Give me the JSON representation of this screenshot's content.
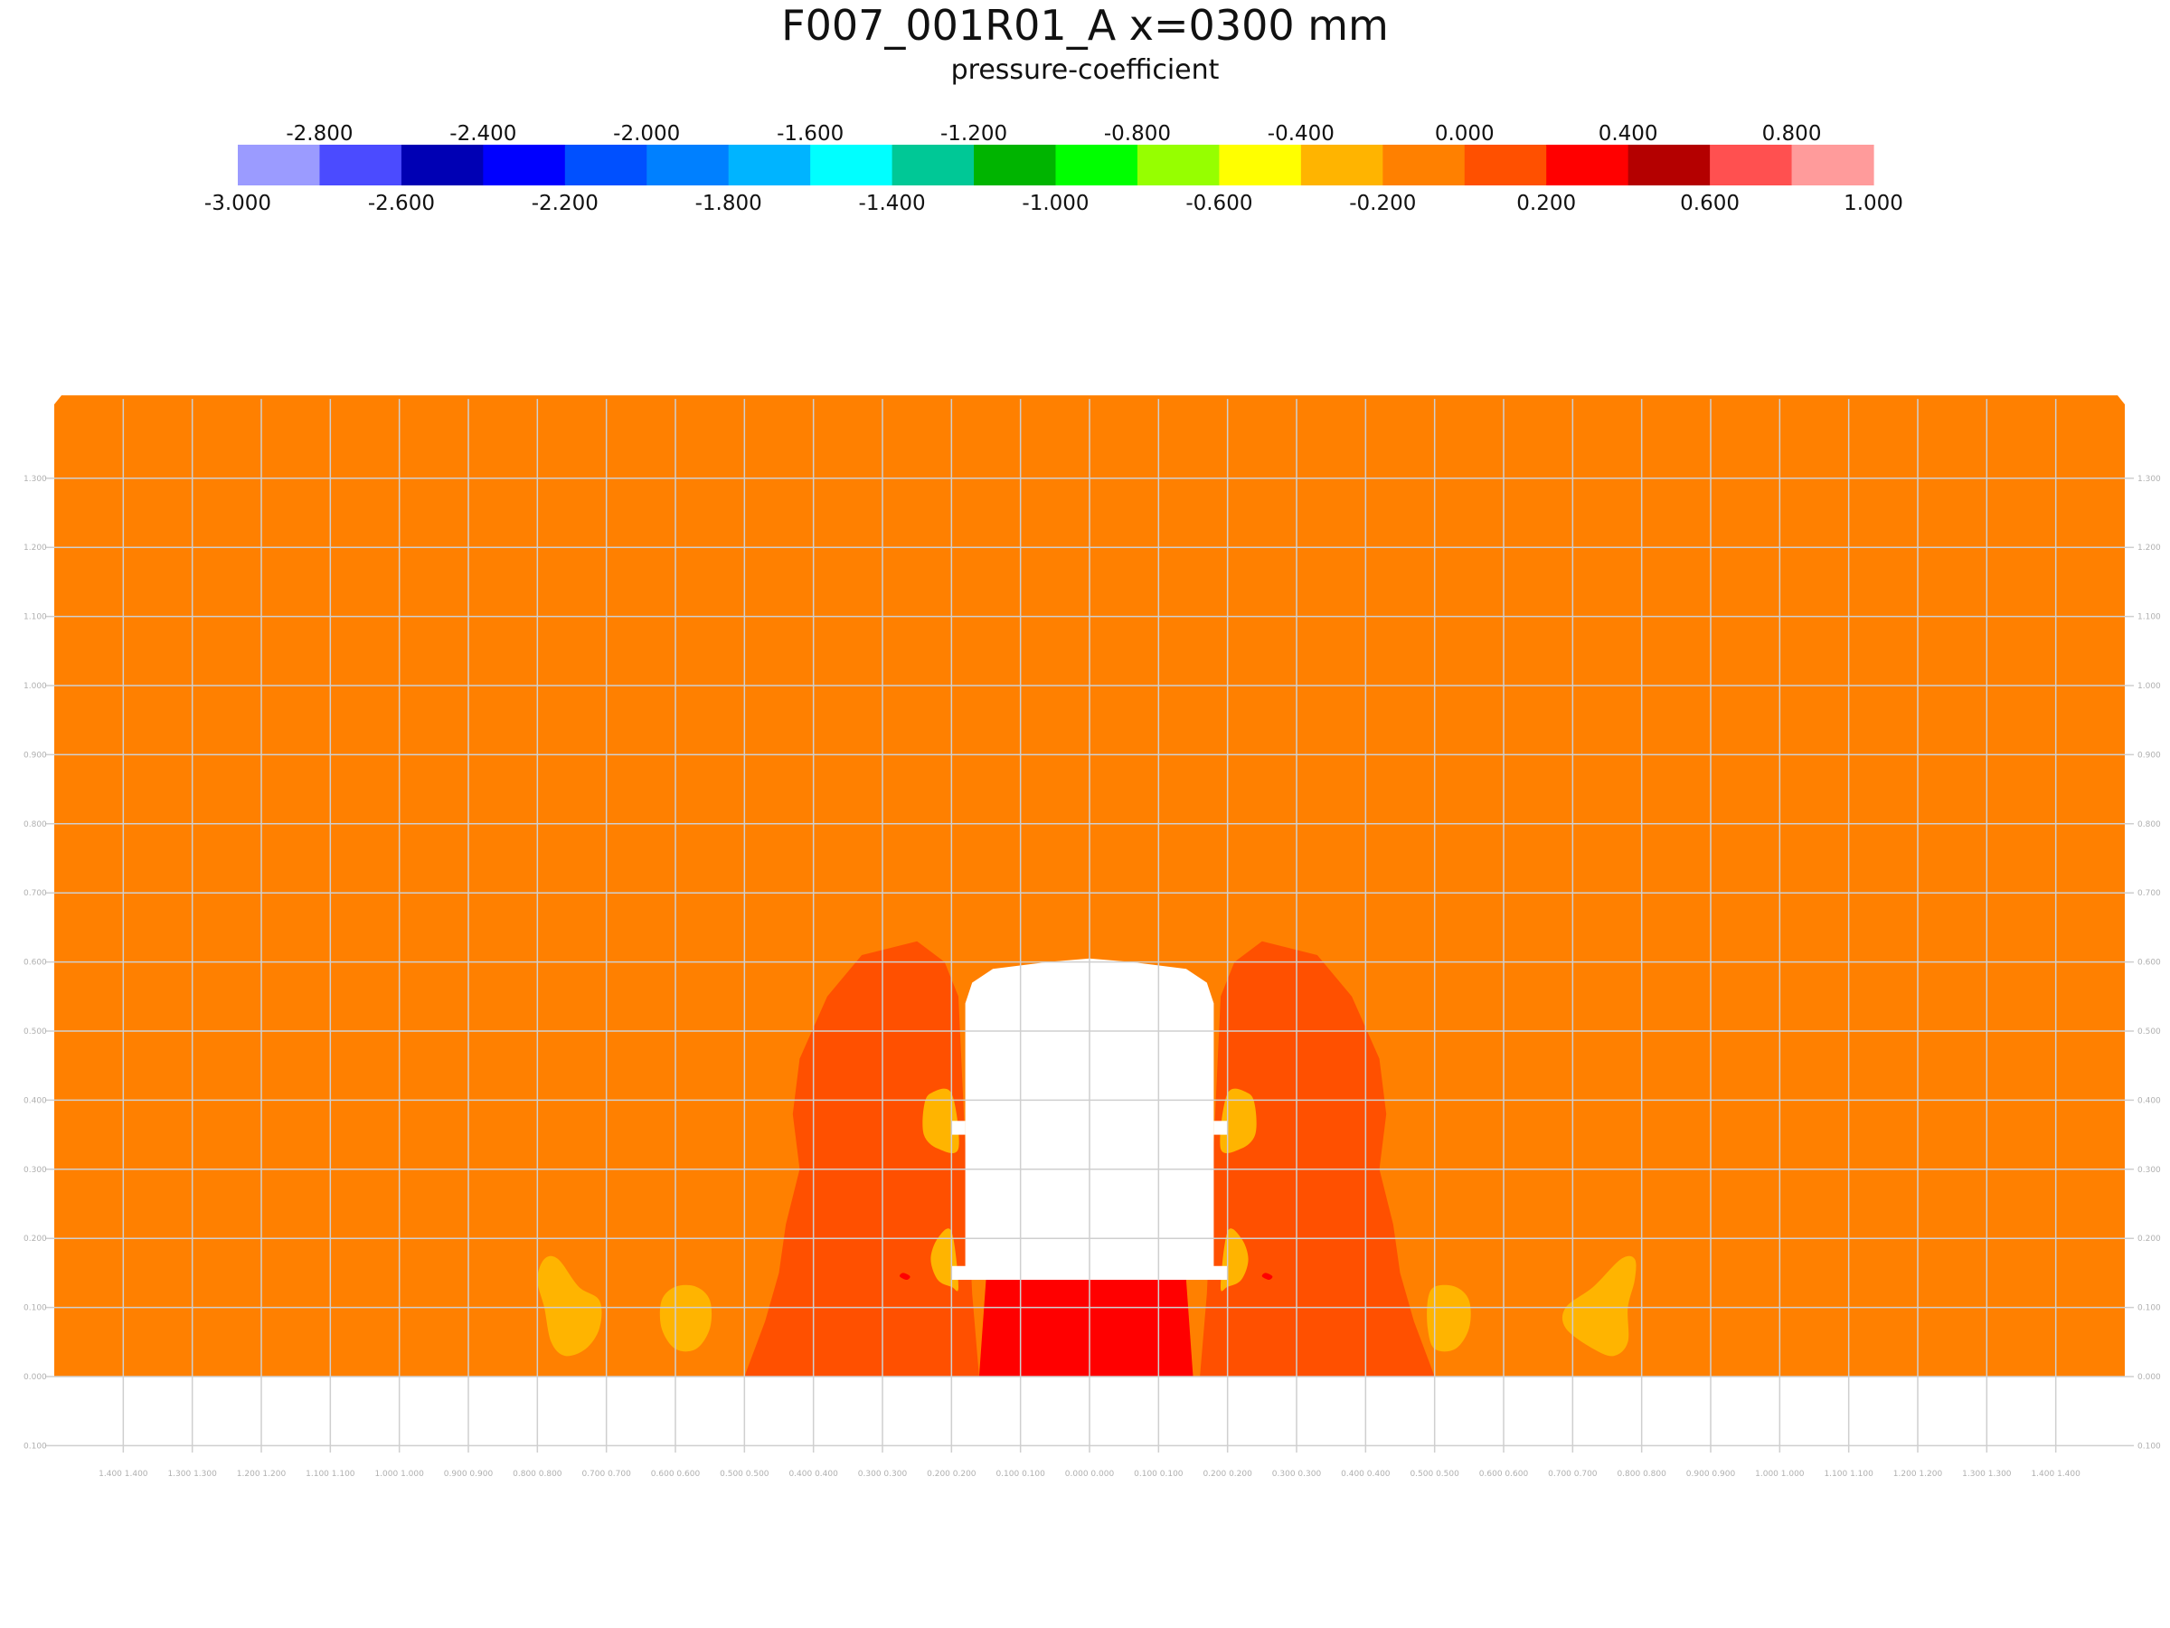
{
  "chart_data": {
    "type": "heatmap",
    "title": "F007_001R01_A x=0300 mm",
    "subtitle": "pressure-coefficient",
    "colorbar": {
      "placement": "top",
      "levels": [
        -3.0,
        -2.8,
        -2.6,
        -2.4,
        -2.2,
        -2.0,
        -1.8,
        -1.6,
        -1.4,
        -1.2,
        -1.0,
        -0.8,
        -0.6,
        -0.4,
        -0.2,
        0.0,
        0.2,
        0.4,
        0.6,
        0.8,
        1.0
      ],
      "level_labels": [
        "-3.000",
        "-2.800",
        "-2.600",
        "-2.400",
        "-2.200",
        "-2.000",
        "-1.800",
        "-1.600",
        "-1.400",
        "-1.200",
        "-1.000",
        "-0.800",
        "-0.600",
        "-0.400",
        "-0.200",
        "0.000",
        "0.200",
        "0.400",
        "0.600",
        "0.800",
        "1.000"
      ],
      "colors": [
        "#9b9bff",
        "#4b4bff",
        "#0000b4",
        "#0000ff",
        "#0050ff",
        "#0080ff",
        "#00b4ff",
        "#00ffff",
        "#00c896",
        "#00b400",
        "#00ff00",
        "#96ff00",
        "#ffff00",
        "#ffb400",
        "#ff8000",
        "#ff5000",
        "#ff0000",
        "#b40000",
        "#ff5050",
        "#ff9b9b"
      ]
    },
    "xlim": [
      -1.5,
      1.5
    ],
    "ylim": [
      -0.1,
      1.4
    ],
    "grid": true,
    "x_ticks": [
      -1.4,
      -1.3,
      -1.2,
      -1.1,
      -1.0,
      -0.9,
      -0.8,
      -0.7,
      -0.6,
      -0.5,
      -0.4,
      -0.3,
      -0.2,
      -0.1,
      0.0,
      0.1,
      0.2,
      0.3,
      0.4,
      0.5,
      0.6,
      0.7,
      0.8,
      0.9,
      1.0,
      1.1,
      1.2,
      1.3,
      1.4
    ],
    "x_tick_labels": [
      "1.400 1.400",
      "1.300 1.300",
      "1.200 1.200",
      "1.100 1.100",
      "1.000 1.000",
      "0.900 0.900",
      "0.800 0.800",
      "0.700 0.700",
      "0.600 0.600",
      "0.500 0.500",
      "0.400 0.400",
      "0.300 0.300",
      "0.200 0.200",
      "0.100 0.100",
      "0.000 0.000",
      "0.100 0.100",
      "0.200 0.200",
      "0.300 0.300",
      "0.400 0.400",
      "0.500 0.500",
      "0.600 0.600",
      "0.700 0.700",
      "0.800 0.800",
      "0.900 0.900",
      "1.000 1.000",
      "1.100 1.100",
      "1.200 1.200",
      "1.300 1.300",
      "1.400 1.400"
    ],
    "y_ticks": [
      -0.1,
      0.0,
      0.1,
      0.2,
      0.3,
      0.4,
      0.5,
      0.6,
      0.7,
      0.8,
      0.9,
      1.0,
      1.1,
      1.2,
      1.3
    ],
    "y_tick_labels": [
      "0.100",
      "0.000",
      "0.100",
      "0.200",
      "0.300",
      "0.400",
      "0.500",
      "0.600",
      "0.700",
      "0.800",
      "0.900",
      "1.000",
      "1.100",
      "1.200",
      "1.300"
    ],
    "field_extent": {
      "x": [
        -1.5,
        1.5
      ],
      "y": [
        0.0,
        1.42
      ]
    },
    "background_level_color": "#ff8000",
    "regions": [
      {
        "name": "side-region-left",
        "color": "#ff5000",
        "points": [
          [
            -0.5,
            0.0
          ],
          [
            -0.47,
            0.08
          ],
          [
            -0.45,
            0.15
          ],
          [
            -0.44,
            0.22
          ],
          [
            -0.42,
            0.3
          ],
          [
            -0.43,
            0.38
          ],
          [
            -0.42,
            0.46
          ],
          [
            -0.38,
            0.55
          ],
          [
            -0.33,
            0.61
          ],
          [
            -0.25,
            0.63
          ],
          [
            -0.21,
            0.6
          ],
          [
            -0.19,
            0.55
          ],
          [
            -0.17,
            0.12
          ],
          [
            -0.16,
            0.0
          ]
        ]
      },
      {
        "name": "side-region-right",
        "color": "#ff5000",
        "points": [
          [
            0.5,
            0.0
          ],
          [
            0.47,
            0.08
          ],
          [
            0.45,
            0.15
          ],
          [
            0.44,
            0.22
          ],
          [
            0.42,
            0.3
          ],
          [
            0.43,
            0.38
          ],
          [
            0.42,
            0.46
          ],
          [
            0.38,
            0.55
          ],
          [
            0.33,
            0.61
          ],
          [
            0.25,
            0.63
          ],
          [
            0.21,
            0.6
          ],
          [
            0.19,
            0.55
          ],
          [
            0.17,
            0.12
          ],
          [
            0.16,
            0.0
          ]
        ]
      },
      {
        "name": "underbody-region",
        "color": "#ff0000",
        "points": [
          [
            -0.16,
            0.0
          ],
          [
            -0.15,
            0.14
          ],
          [
            0.14,
            0.14
          ],
          [
            0.15,
            0.0
          ]
        ]
      },
      {
        "name": "blob-outer-left",
        "color": "#ffb400",
        "points": [
          [
            -0.79,
            0.17
          ],
          [
            -0.8,
            0.14
          ],
          [
            -0.79,
            0.1
          ],
          [
            -0.78,
            0.05
          ],
          [
            -0.76,
            0.03
          ],
          [
            -0.73,
            0.04
          ],
          [
            -0.71,
            0.07
          ],
          [
            -0.71,
            0.11
          ],
          [
            -0.74,
            0.13
          ],
          [
            -0.77,
            0.17
          ]
        ]
      },
      {
        "name": "blob-inner-left",
        "color": "#ffb400",
        "points": [
          [
            -0.6,
            0.13
          ],
          [
            -0.57,
            0.13
          ],
          [
            -0.55,
            0.11
          ],
          [
            -0.55,
            0.07
          ],
          [
            -0.57,
            0.04
          ],
          [
            -0.6,
            0.04
          ],
          [
            -0.62,
            0.07
          ],
          [
            -0.62,
            0.11
          ]
        ]
      },
      {
        "name": "blob-inner-right",
        "color": "#ffb400",
        "points": [
          [
            0.5,
            0.13
          ],
          [
            0.53,
            0.13
          ],
          [
            0.55,
            0.11
          ],
          [
            0.55,
            0.07
          ],
          [
            0.53,
            0.04
          ],
          [
            0.5,
            0.04
          ],
          [
            0.49,
            0.07
          ],
          [
            0.49,
            0.11
          ]
        ]
      },
      {
        "name": "blob-outer-right",
        "color": "#ffb400",
        "points": [
          [
            0.79,
            0.17
          ],
          [
            0.79,
            0.14
          ],
          [
            0.78,
            0.1
          ],
          [
            0.78,
            0.05
          ],
          [
            0.76,
            0.03
          ],
          [
            0.73,
            0.04
          ],
          [
            0.69,
            0.07
          ],
          [
            0.69,
            0.1
          ],
          [
            0.73,
            0.13
          ],
          [
            0.77,
            0.17
          ]
        ]
      },
      {
        "name": "mirror-blob-left",
        "color": "#ffb400",
        "points": [
          [
            -0.2,
            0.41
          ],
          [
            -0.23,
            0.41
          ],
          [
            -0.24,
            0.39
          ],
          [
            -0.24,
            0.35
          ],
          [
            -0.22,
            0.33
          ],
          [
            -0.19,
            0.33
          ]
        ]
      },
      {
        "name": "mirror-blob-right",
        "color": "#ffb400",
        "points": [
          [
            0.2,
            0.41
          ],
          [
            0.23,
            0.41
          ],
          [
            0.24,
            0.39
          ],
          [
            0.24,
            0.35
          ],
          [
            0.22,
            0.33
          ],
          [
            0.19,
            0.33
          ]
        ]
      },
      {
        "name": "wheel-blob-left",
        "color": "#ffb400",
        "points": [
          [
            -0.2,
            0.21
          ],
          [
            -0.22,
            0.2
          ],
          [
            -0.23,
            0.17
          ],
          [
            -0.22,
            0.14
          ],
          [
            -0.2,
            0.13
          ],
          [
            -0.19,
            0.13
          ]
        ]
      },
      {
        "name": "wheel-blob-right",
        "color": "#ffb400",
        "points": [
          [
            0.2,
            0.21
          ],
          [
            0.22,
            0.2
          ],
          [
            0.23,
            0.17
          ],
          [
            0.22,
            0.14
          ],
          [
            0.2,
            0.13
          ],
          [
            0.19,
            0.13
          ]
        ]
      },
      {
        "name": "spot-left",
        "color": "#ff0000",
        "points": [
          [
            -0.27,
            0.15
          ],
          [
            -0.26,
            0.145
          ],
          [
            -0.265,
            0.14
          ],
          [
            -0.275,
            0.145
          ]
        ]
      },
      {
        "name": "spot-right",
        "color": "#ff0000",
        "points": [
          [
            0.255,
            0.15
          ],
          [
            0.265,
            0.145
          ],
          [
            0.26,
            0.14
          ],
          [
            0.25,
            0.145
          ]
        ]
      }
    ],
    "vehicle_section": {
      "color": "#ffffff",
      "points": [
        [
          -0.18,
          0.14
        ],
        [
          -0.18,
          0.54
        ],
        [
          -0.17,
          0.57
        ],
        [
          -0.14,
          0.59
        ],
        [
          -0.06,
          0.6
        ],
        [
          0.0,
          0.605
        ],
        [
          0.06,
          0.6
        ],
        [
          0.14,
          0.59
        ],
        [
          0.17,
          0.57
        ],
        [
          0.18,
          0.54
        ],
        [
          0.18,
          0.14
        ]
      ],
      "mirror_bars": [
        [
          -0.2,
          0.35,
          -0.18,
          0.37
        ],
        [
          0.18,
          0.35,
          0.2,
          0.37
        ]
      ],
      "sill_bars": [
        [
          -0.2,
          0.14,
          0.2,
          0.16
        ]
      ]
    }
  }
}
